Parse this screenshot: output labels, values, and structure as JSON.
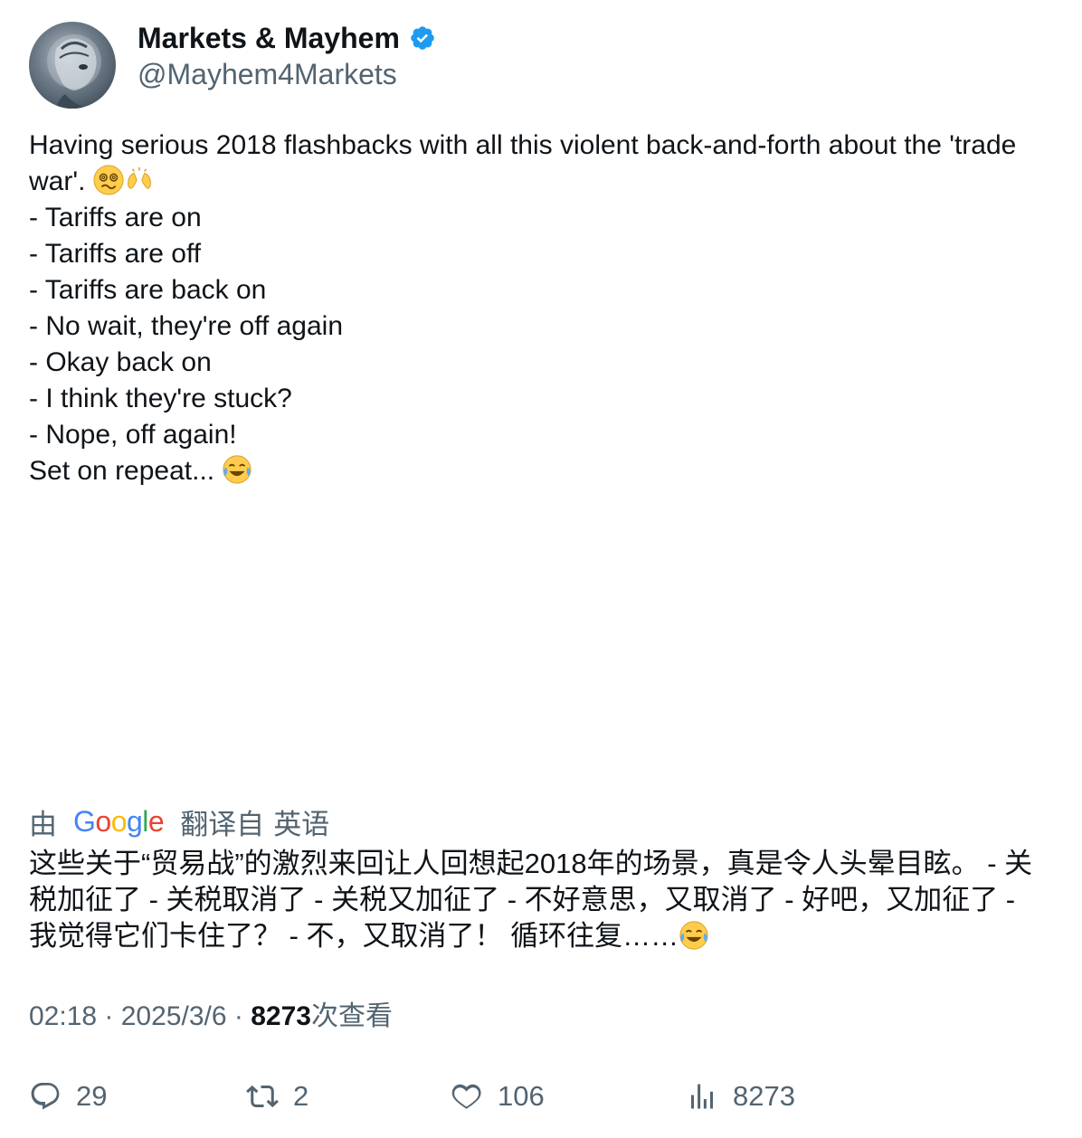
{
  "author": {
    "name": "Markets & Mayhem",
    "handle": "@Mayhem4Markets",
    "verified_color": "#1d9bf0"
  },
  "tweet": {
    "line1": "Having serious 2018 flashbacks with all this violent back-and-forth about the 'trade war'.",
    "lines": [
      "- Tariffs are on",
      "- Tariffs are off",
      "- Tariffs are back on",
      "- No wait, they're off again",
      "- Okay back on",
      "- I think they're stuck?",
      "- Nope, off again!"
    ],
    "closing": "Set on repeat...",
    "emojis": [
      "woozy-face-emoji",
      "clapping-hands-emoji",
      "tears-of-joy-emoji"
    ]
  },
  "translate": {
    "prefix": "由",
    "brand": "Google",
    "suffix": "翻译自",
    "language": "英语",
    "text": "这些关于“贸易战”的激烈来回让人回想起2018年的场景，真是令人头晕目眩。 - 关税加征了 - 关税取消了 - 关税又加征了 - 不好意思，又取消了 - 好吧，又加征了 - 我觉得它们卡住了？ - 不，又取消了！ 循环往复……"
  },
  "meta": {
    "time": "02:18",
    "date": "2025/3/6",
    "views": "8273",
    "views_label": "次查看"
  },
  "actions": {
    "replies": "29",
    "retweets": "2",
    "likes": "106",
    "views": "8273"
  },
  "colors": {
    "text": "#0f1419",
    "secondary": "#536471",
    "accent": "#1d9bf0"
  }
}
